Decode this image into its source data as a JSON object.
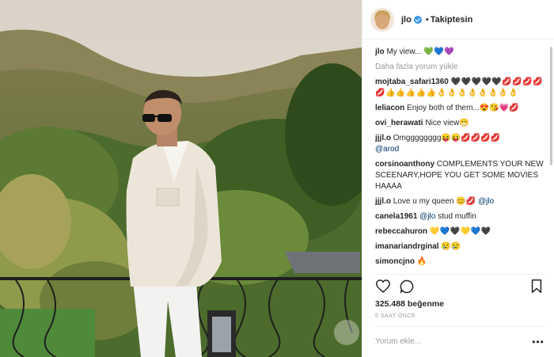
{
  "post": {
    "username": "jlo",
    "separator": "•",
    "follow_status": "Takiptesin",
    "caption_user": "jlo",
    "caption_text": "My view...",
    "caption_emoji": "💚💙💜",
    "load_more": "Daha fazla yorum yükle",
    "likes": "325.488 beğenme",
    "time_ago": "5 SAAT ÖNCE",
    "comment_placeholder": "Yorum ekle...",
    "more_options": "•••"
  },
  "comments": [
    {
      "user": "mojtaba_safari1360",
      "text": "🖤🖤🖤🖤🖤💋💋💋💋💋👍👍👍👍👍👌👌👌👌👌👌👌👌"
    },
    {
      "user": "leliacon",
      "text": "Enjoy both of them...😍😘💗💋"
    },
    {
      "user": "ovi_herawati",
      "text": "Nice view😁"
    },
    {
      "user": "jjjl.o",
      "text": "Omgggggggg😝😝💋💋💋💋",
      "mention": "@arod"
    },
    {
      "user": "corsinoanthony",
      "text": "COMPLEMENTS YOUR NEW SCEENARY,HOPE YOU GET SOME MOVIES HAAAA"
    },
    {
      "user": "jjjl.o",
      "text": "Love u my queen 😊💋",
      "mention": "@jlo"
    },
    {
      "user": "canela1961",
      "text": "stud muffin",
      "mention": "@jlo"
    },
    {
      "user": "rebeccahuron",
      "text": "💛💙🖤💛💙🖤"
    },
    {
      "user": "imanariandrginal",
      "text": "😢😢"
    },
    {
      "user": "simoncjno",
      "text": "🔥"
    }
  ],
  "icons": [
    "heart-icon",
    "comment-icon",
    "bookmark-icon",
    "verified-icon",
    "more-icon"
  ],
  "colors": {
    "verified": "#3897f0",
    "mention": "#003569",
    "muted": "#999999",
    "text": "#262626"
  }
}
